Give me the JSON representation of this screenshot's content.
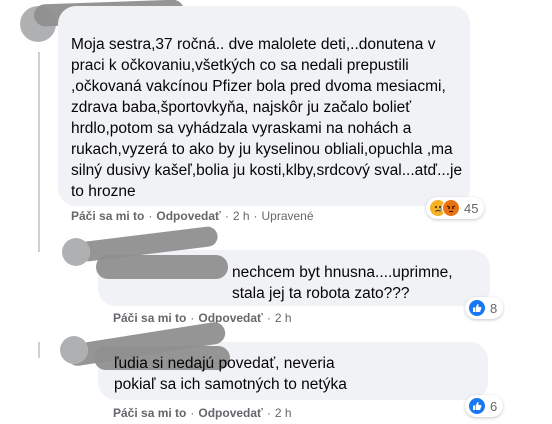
{
  "colors": {
    "bubble": "#f0f2f5",
    "meta": "#65676b",
    "like": "#1877f2",
    "sad": "#f7b125",
    "angry": "#e9710f"
  },
  "comments": [
    {
      "text": "Moja sestra,37 ročná.. dve malolete deti,..donutena v\npraci k očkovaniu,všetkých co sa nedali prepustili\n,očkovaná vakcínou Pfizer bola pred dvoma mesiacmi,\nzdrava baba,športovkyňa, najskôr ju začalo bolieť\nhrdlo,potom sa vyhádzala vyraskami na nohách a\nrukach,vyzerá to ako by ju kyselinou obliali,opuchla ,ma\nsilný dusivy kašeľ,bolia ju kosti,klby,srdcový sval...atď...je\nto hrozne",
      "like_label": "Páči sa mi to",
      "reply_label": "Odpovedať",
      "time": "2 h",
      "edited": "Upravené",
      "reactions": [
        "sad-icon",
        "angry-icon"
      ],
      "reaction_count": "45"
    },
    {
      "text": "nechcem byt hnusna....uprimne,\nstala jej ta robota zato???",
      "like_label": "Páči sa mi to",
      "reply_label": "Odpovedať",
      "time": "2 h",
      "reactions": [
        "like-icon"
      ],
      "reaction_count": "8"
    },
    {
      "text": "ľudia si nedajú povedať, neveria\npokiaľ sa ich samotných to netýka",
      "like_label": "Páči sa mi to",
      "reply_label": "Odpovedať",
      "time": "2 h",
      "reactions": [
        "like-icon"
      ],
      "reaction_count": "6"
    }
  ]
}
